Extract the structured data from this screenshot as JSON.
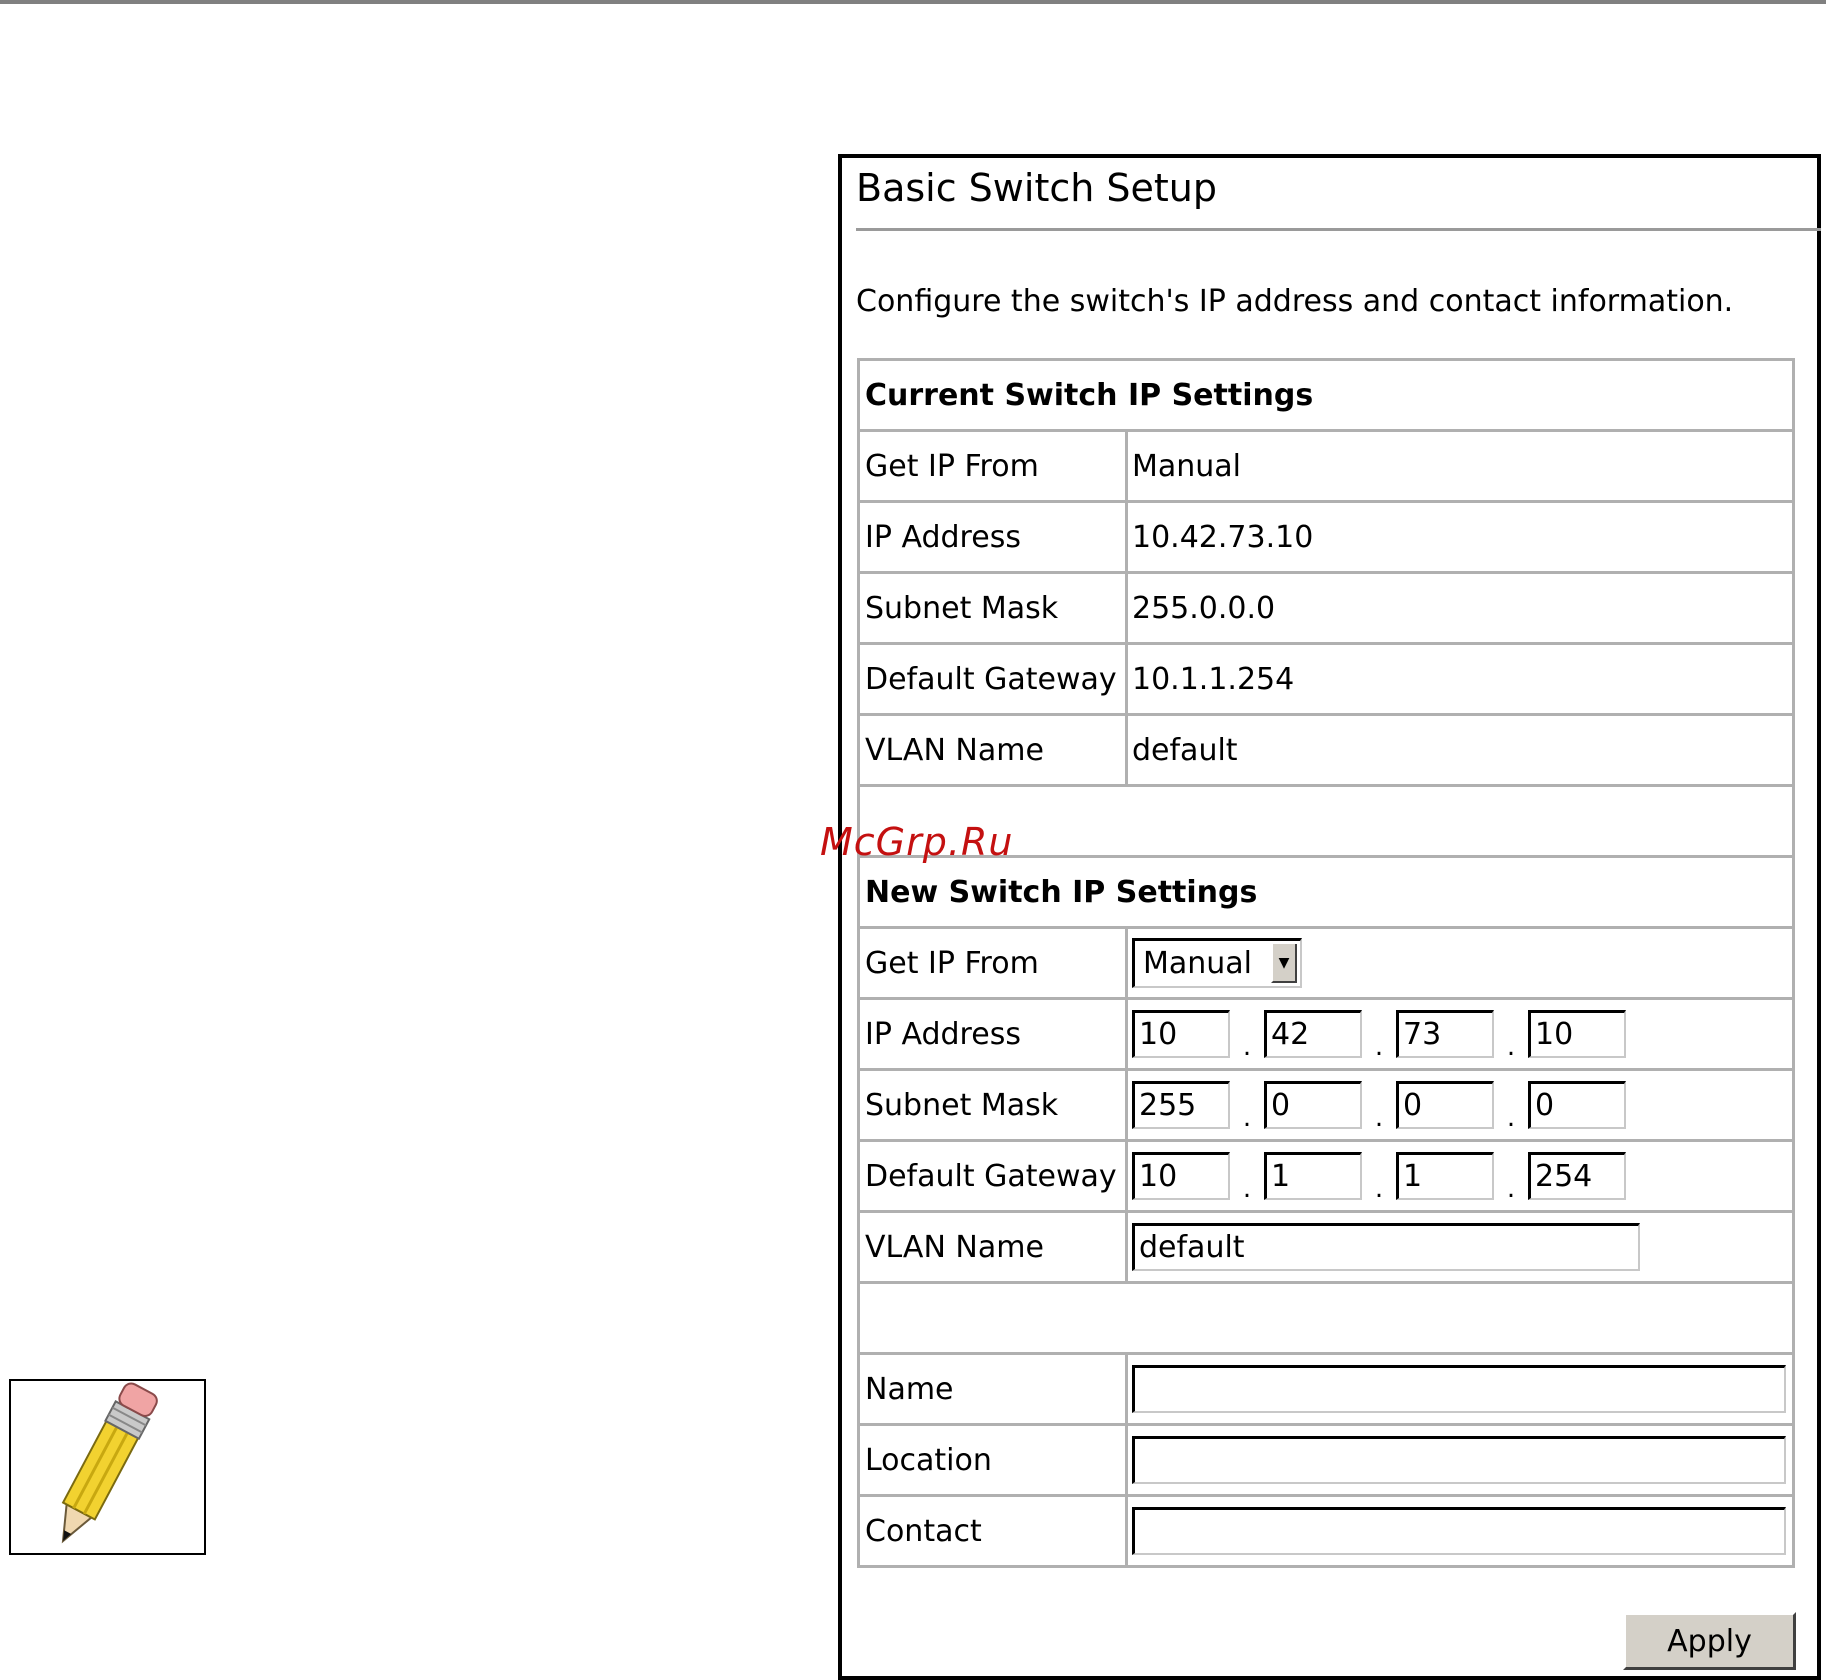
{
  "watermark": "McGrp.Ru",
  "panel": {
    "title": "Basic Switch Setup",
    "description": "Configure the switch's IP address and contact information."
  },
  "current_settings": {
    "heading": "Current Switch IP Settings",
    "rows": [
      {
        "label": "Get IP From",
        "value": "Manual"
      },
      {
        "label": "IP Address",
        "value": "10.42.73.10"
      },
      {
        "label": "Subnet Mask",
        "value": "255.0.0.0"
      },
      {
        "label": "Default Gateway",
        "value": "10.1.1.254"
      },
      {
        "label": "VLAN Name",
        "value": "default"
      }
    ]
  },
  "new_settings": {
    "heading": "New Switch IP Settings",
    "get_ip_from": {
      "label": "Get IP From",
      "selected": "Manual"
    },
    "ip_address": {
      "label": "IP Address",
      "octets": [
        "10",
        "42",
        "73",
        "10"
      ]
    },
    "subnet_mask": {
      "label": "Subnet Mask",
      "octets": [
        "255",
        "0",
        "0",
        "0"
      ]
    },
    "default_gateway": {
      "label": "Default Gateway",
      "octets": [
        "10",
        "1",
        "1",
        "254"
      ]
    },
    "vlan_name": {
      "label": "VLAN Name",
      "value": "default"
    },
    "separator": "."
  },
  "contact": {
    "name": {
      "label": "Name",
      "value": ""
    },
    "location": {
      "label": "Location",
      "value": ""
    },
    "contact": {
      "label": "Contact",
      "value": ""
    }
  },
  "buttons": {
    "apply": "Apply"
  },
  "icons": {
    "note": "pencil-icon",
    "dropdown": "chevron-down-icon"
  }
}
